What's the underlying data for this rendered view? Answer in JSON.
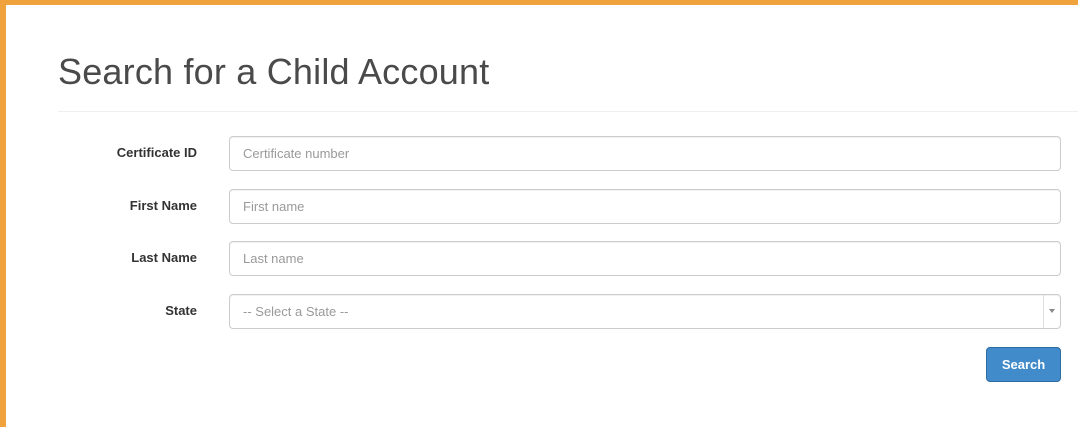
{
  "page": {
    "title": "Search for a Child Account"
  },
  "form": {
    "certificate": {
      "label": "Certificate ID",
      "placeholder": "Certificate number",
      "value": ""
    },
    "first_name": {
      "label": "First Name",
      "placeholder": "First name",
      "value": ""
    },
    "last_name": {
      "label": "Last Name",
      "placeholder": "Last name",
      "value": ""
    },
    "state": {
      "label": "State",
      "selected": "-- Select a State --"
    },
    "search_label": "Search"
  },
  "colors": {
    "frame_border": "#f0a23c",
    "button_primary": "#428bca",
    "title_text": "#4a4a4a"
  },
  "icons": {
    "select_arrow": "chevron-down-icon"
  }
}
